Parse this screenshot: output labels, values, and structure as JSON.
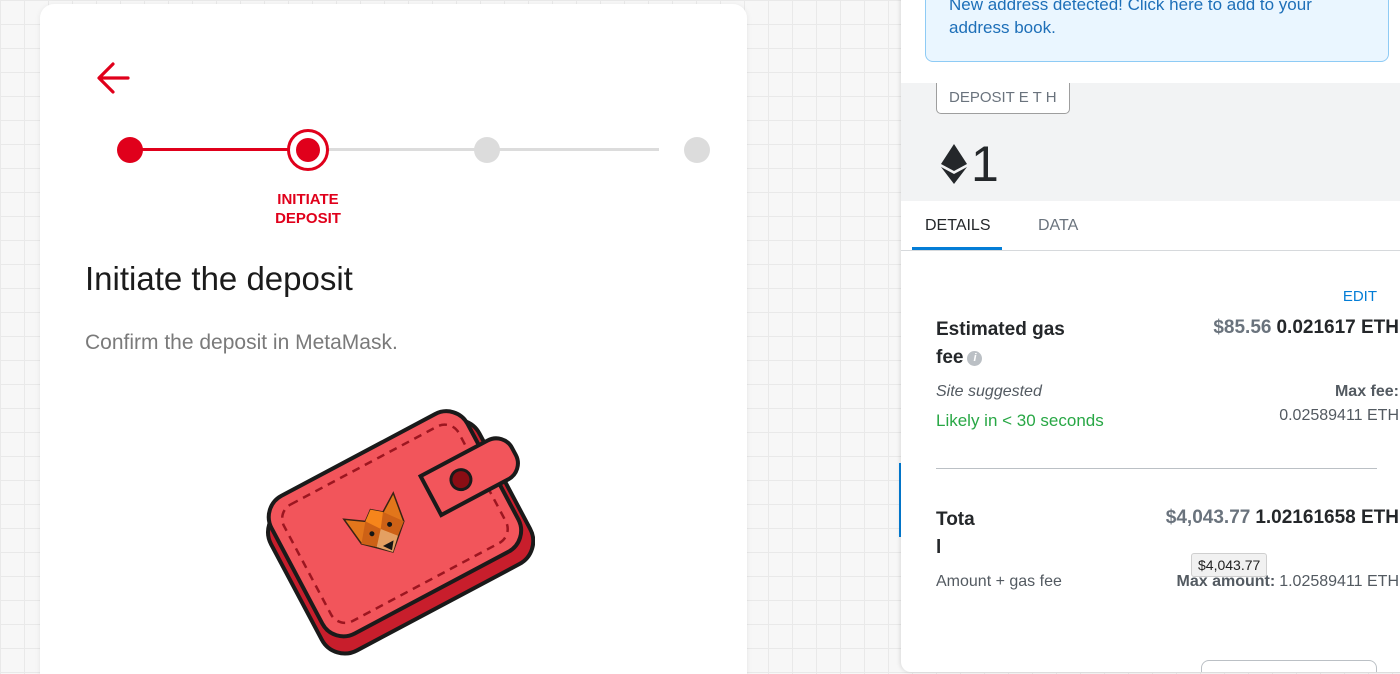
{
  "bridge": {
    "back_icon": "arrow-left-icon",
    "active_step_label": "INITIATE\nDEPOSIT",
    "title": "Initiate the deposit",
    "subtitle": "Confirm the deposit in MetaMask.",
    "illustration": "metamask-wallet-illustration",
    "accent_color": "#e0001b",
    "inactive_color": "#dcdcdc",
    "steps_total": 4,
    "current_step": 2
  },
  "metamask": {
    "alert_text": "New address detected! Click here to add to your address book.",
    "method_pill": "DEPOSIT E T H",
    "amount_icon": "ethereum-icon",
    "amount": "1",
    "tabs": [
      {
        "label": "DETAILS",
        "active": true
      },
      {
        "label": "DATA",
        "active": false
      }
    ],
    "edit_label": "EDIT",
    "gas": {
      "label": "Estimated gas fee",
      "usd": "$85.56",
      "eth": "0.021617 ETH",
      "site_suggested": "Site suggested",
      "likely": "Likely in < 30 seconds",
      "max_fee_label": "Max fee:",
      "max_fee_value": "0.02589411 ETH"
    },
    "total": {
      "label": "Tota\nl",
      "usd": "$4,043.77",
      "eth": "1.02161658 ETH",
      "tooltip": "$4,043.77",
      "amount_plus_gas": "Amount + gas fee",
      "max_amount_label": "Max amount:",
      "max_amount_value": "1.02589411 ETH"
    },
    "accent_color": "#037dd6",
    "success_color": "#28a745"
  }
}
